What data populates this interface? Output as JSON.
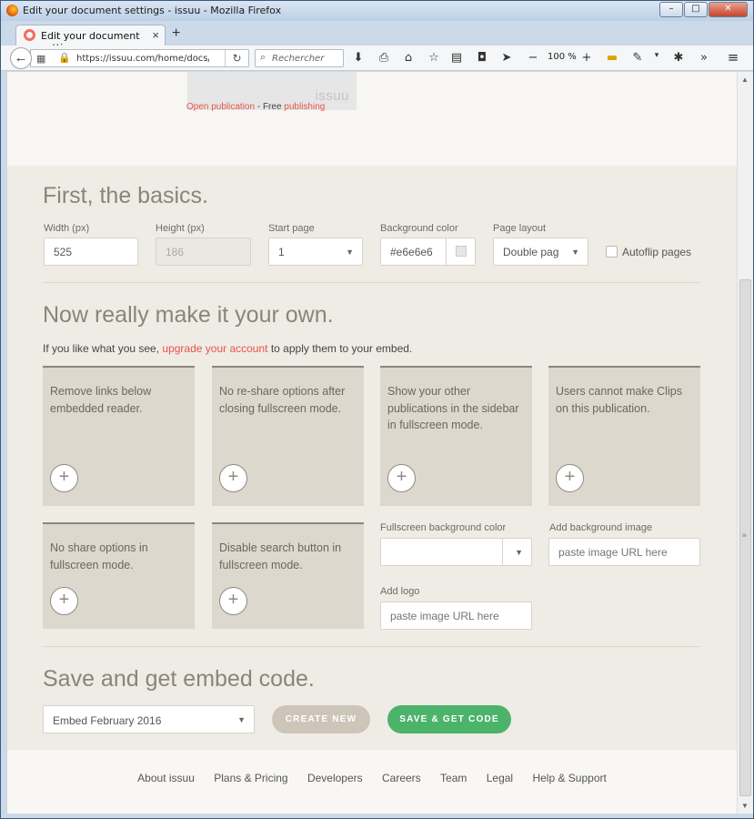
{
  "window": {
    "title": "Edit your document settings - issuu - Mozilla Firefox",
    "buttons": {
      "minimize": "–",
      "maximize": "□",
      "close": "✕"
    }
  },
  "tabs": [
    {
      "label": "Edit your document settin...",
      "close": "×"
    }
  ],
  "new_tab": "+",
  "navbar": {
    "url": "https://issuu.com/home/docs/com",
    "search_placeholder": "Rechercher",
    "zoom": "100 %",
    "zoom_out": "−",
    "zoom_in": "+",
    "overflow": "»",
    "menu": "≡"
  },
  "preview": {
    "logo": "issuu",
    "open_publication": "Open publication",
    "separator": " - Free ",
    "publishing": "publishing"
  },
  "basics": {
    "title": "First, the basics.",
    "width_label": "Width (px)",
    "width_value": "525",
    "height_label": "Height (px)",
    "height_value": "186",
    "start_page_label": "Start page",
    "start_page_value": "1",
    "bg_color_label": "Background color",
    "bg_color_value": "#e6e6e6",
    "page_layout_label": "Page layout",
    "page_layout_value": "Double pag",
    "autoflip_label": "Autoflip pages",
    "autoflip_checked": false
  },
  "own": {
    "title": "Now really make it your own.",
    "lead_before": "If you like what you see, ",
    "lead_link": "upgrade your account",
    "lead_after": " to apply them to your embed.",
    "cards": [
      "Remove links below embedded reader.",
      "No re-share options after closing fullscreen mode.",
      "Show your other publications in the sidebar in fullscreen mode.",
      "Users cannot make Clips on this publication.",
      "No share options in fullscreen mode.",
      "Disable search button in fullscreen mode."
    ],
    "plus": "+",
    "fullscreen_bg_label": "Fullscreen background color",
    "fullscreen_bg_value": "",
    "bg_image_label": "Add background image",
    "bg_image_placeholder": "paste image URL here",
    "logo_label": "Add logo",
    "logo_placeholder": "paste image URL here"
  },
  "save": {
    "title": "Save and get embed code.",
    "embed_select": "Embed February 2016",
    "create_new": "CREATE NEW",
    "save_get_code": "SAVE & GET CODE"
  },
  "footer": {
    "links": [
      "About issuu",
      "Plans & Pricing",
      "Developers",
      "Careers",
      "Team",
      "Legal",
      "Help & Support"
    ]
  }
}
